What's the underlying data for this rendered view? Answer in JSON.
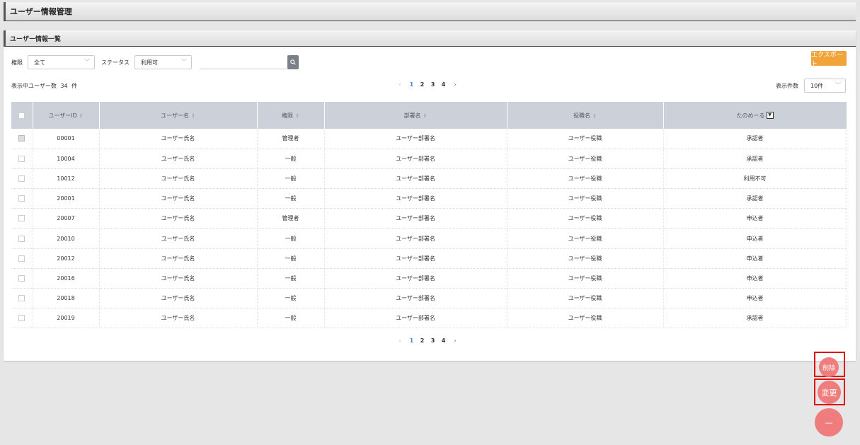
{
  "page": {
    "title": "ユーザー情報管理"
  },
  "panel": {
    "title": "ユーザー情報一覧"
  },
  "filters": {
    "authority_label": "権限",
    "authority_value": "全て",
    "status_label": "ステータス",
    "status_value": "利用可",
    "search_placeholder": "",
    "export_label": "エクスポート"
  },
  "summary": {
    "count_label": "表示中ユーザー数",
    "count_value": "34",
    "count_unit": "件",
    "per_page_label": "表示件数",
    "per_page_value": "10件"
  },
  "pagination": {
    "pages": [
      "1",
      "2",
      "3",
      "4"
    ],
    "current": "1",
    "prev": "‹",
    "next": "›"
  },
  "table": {
    "headers": [
      "ユーザーID",
      "ユーザー名",
      "権限",
      "部署名",
      "役職名",
      "たのめーる"
    ],
    "rows": [
      {
        "id": "00001",
        "name": "ユーザー氏名",
        "role": "管理者",
        "dept": "ユーザー部署名",
        "title": "ユーザー役職",
        "tanomeru": "承認者"
      },
      {
        "id": "10004",
        "name": "ユーザー氏名",
        "role": "一般",
        "dept": "ユーザー部署名",
        "title": "ユーザー役職",
        "tanomeru": "承認者"
      },
      {
        "id": "10012",
        "name": "ユーザー氏名",
        "role": "一般",
        "dept": "ユーザー部署名",
        "title": "ユーザー役職",
        "tanomeru": "利用不可"
      },
      {
        "id": "20001",
        "name": "ユーザー氏名",
        "role": "一般",
        "dept": "ユーザー部署名",
        "title": "ユーザー役職",
        "tanomeru": "承認者"
      },
      {
        "id": "20007",
        "name": "ユーザー氏名",
        "role": "管理者",
        "dept": "ユーザー部署名",
        "title": "ユーザー役職",
        "tanomeru": "申込者"
      },
      {
        "id": "20010",
        "name": "ユーザー氏名",
        "role": "一般",
        "dept": "ユーザー部署名",
        "title": "ユーザー役職",
        "tanomeru": "申込者"
      },
      {
        "id": "20012",
        "name": "ユーザー氏名",
        "role": "一般",
        "dept": "ユーザー部署名",
        "title": "ユーザー役職",
        "tanomeru": "申込者"
      },
      {
        "id": "20016",
        "name": "ユーザー氏名",
        "role": "一般",
        "dept": "ユーザー部署名",
        "title": "ユーザー役職",
        "tanomeru": "申込者"
      },
      {
        "id": "20018",
        "name": "ユーザー氏名",
        "role": "一般",
        "dept": "ユーザー部署名",
        "title": "ユーザー役職",
        "tanomeru": "申込者"
      },
      {
        "id": "20019",
        "name": "ユーザー氏名",
        "role": "一般",
        "dept": "ユーザー部署名",
        "title": "ユーザー役職",
        "tanomeru": "承認者"
      }
    ]
  },
  "actions": {
    "delete_label": "削除",
    "edit_label": "変更",
    "menu_label": "—"
  },
  "colors": {
    "accent": "#3a8ee6",
    "export": "#f0a43a",
    "fab": "#f07d7d",
    "highlight": "#e01010",
    "table_header": "#ccd0d9"
  }
}
